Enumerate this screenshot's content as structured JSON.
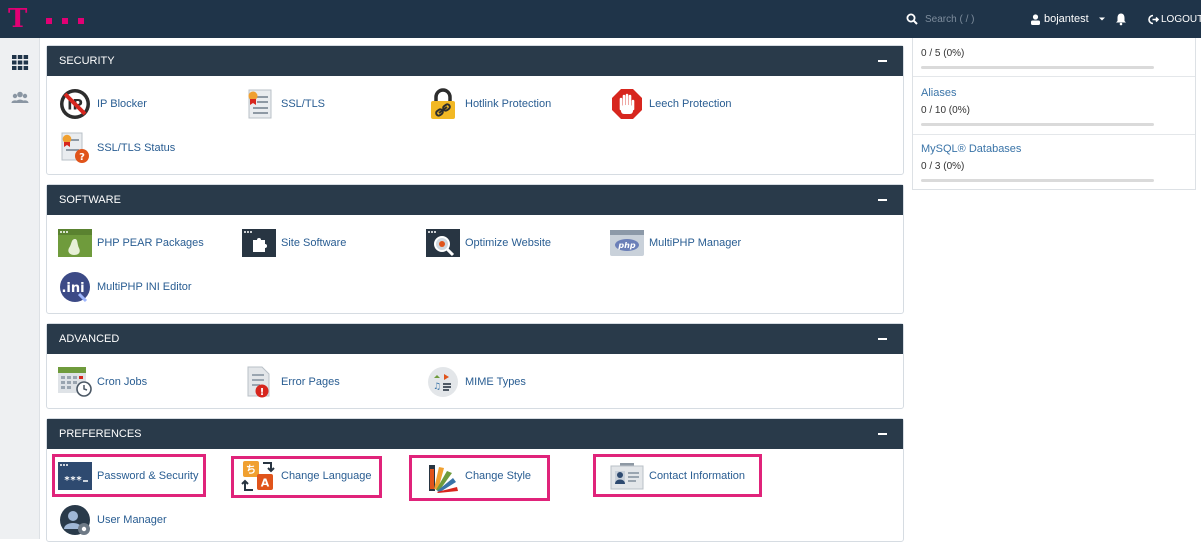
{
  "header": {
    "search_placeholder": "Search ( / )",
    "username": "bojantest",
    "logout_label": "LOGOUT",
    "brand_color": "#e20074"
  },
  "sidebar": {
    "items": [
      {
        "name": "home-grid-icon"
      },
      {
        "name": "users-icon"
      }
    ]
  },
  "groups": [
    {
      "title": "SECURITY",
      "items": [
        {
          "label": "IP Blocker",
          "icon": "ip-blocker-icon"
        },
        {
          "label": "SSL/TLS",
          "icon": "certificate-icon"
        },
        {
          "label": "Hotlink Protection",
          "icon": "padlock-link-icon"
        },
        {
          "label": "Leech Protection",
          "icon": "stop-hand-icon"
        },
        {
          "label": "SSL/TLS Status",
          "icon": "certificate-status-icon"
        }
      ]
    },
    {
      "title": "SOFTWARE",
      "items": [
        {
          "label": "PHP PEAR Packages",
          "icon": "pear-icon"
        },
        {
          "label": "Site Software",
          "icon": "puzzle-icon"
        },
        {
          "label": "Optimize Website",
          "icon": "magnifier-window-icon"
        },
        {
          "label": "MultiPHP Manager",
          "icon": "php-icon"
        },
        {
          "label": "MultiPHP INI Editor",
          "icon": "ini-editor-icon"
        }
      ]
    },
    {
      "title": "ADVANCED",
      "items": [
        {
          "label": "Cron Jobs",
          "icon": "calendar-clock-icon"
        },
        {
          "label": "Error Pages",
          "icon": "error-page-icon"
        },
        {
          "label": "MIME Types",
          "icon": "mime-types-icon"
        }
      ]
    },
    {
      "title": "PREFERENCES",
      "items": [
        {
          "label": "Password & Security",
          "icon": "password-window-icon"
        },
        {
          "label": "Change Language",
          "icon": "language-swap-icon"
        },
        {
          "label": "Change Style",
          "icon": "color-swatch-icon"
        },
        {
          "label": "Contact Information",
          "icon": "contact-card-icon"
        },
        {
          "label": "User Manager",
          "icon": "user-manager-icon"
        }
      ]
    }
  ],
  "stats": [
    {
      "name": "",
      "value": "0 / 5  (0%)",
      "fraction": 0
    },
    {
      "name": "Aliases",
      "value": "0 / 10  (0%)",
      "fraction": 0
    },
    {
      "name": "MySQL® Databases",
      "value": "0 / 3  (0%)",
      "fraction": 0
    }
  ],
  "highlight_color": "#e0237a"
}
